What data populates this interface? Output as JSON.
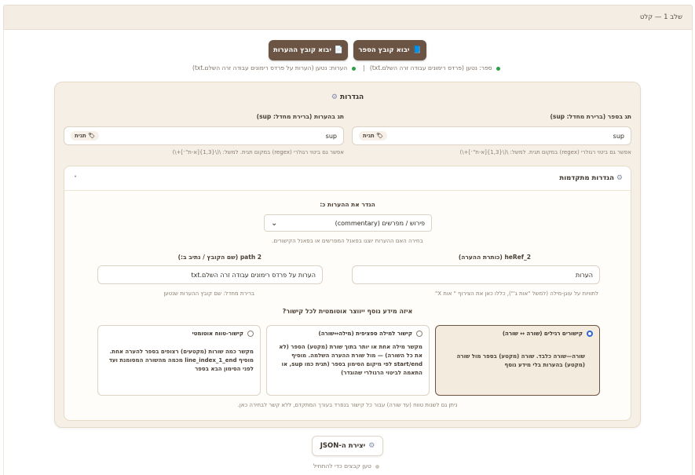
{
  "step": {
    "label": "שלב 1 — קלט"
  },
  "buttons": {
    "import_book": "יבוא קובץ הספר",
    "import_notes": "יבוא קובץ ההערות",
    "create_json": "יצירת ה-JSON"
  },
  "status": {
    "book": "ספר: נטען (פרדס רימונים עבודה זרה השלם.txt)",
    "separator": "|",
    "notes": "הערות: נטען (הערות על פרדס רימונים עבודה זרה השלם.txt)",
    "book_color": "#2e9d4a"
  },
  "settings": {
    "title": "הגדרות",
    "book_tag": {
      "label": "תג בספר (ברירת מחדל: sup)",
      "value": "sup",
      "chip": "תגית",
      "hint": "אפשר גם ביטוי רגולרי (regex) במקום תגית. למשל: \\(\\{1,3}[א-ת\"׳]+\\)"
    },
    "notes_tag": {
      "label": "תג בהערות (ברירת מחדל: sup)",
      "value": "sup",
      "chip": "תגית",
      "hint": "אפשר גם ביטוי רגולרי (regex) במקום תגית. למשל: \\(\\{1,3}[א-ת\"׳]+\\)"
    }
  },
  "advanced": {
    "title": "הגדרות מתקדמות",
    "caret": "˄",
    "define_label": "הגדר את ההערות כ:",
    "select_value": "פירוש / מפרשים (commentary)",
    "select_hint": "בחירה האם ההערות יוצגו בפאנל המפרשים או בפאנל הקישורים.",
    "heref": {
      "label": "heRef_2 (כותרת ההערה)",
      "value": "הערות",
      "hint": "לתוויות על עוגן-מילה (למשל \"אות ג'\"), כללו כאן את הצירוף \" אות X\""
    },
    "path": {
      "label": "path 2 (שם הקובץ / נתיב ב:)",
      "value": "הערות על פרדס רימונים עבודה זרה השלם.txt",
      "hint": "ברירת מחדל: שם קובץ ההערות שנטען"
    },
    "question": "איזה מידע נוסף ייווצר אוטומטית לכל קישור?",
    "options": [
      {
        "title": "קישורים רגילים (שורה ↔ שורה)",
        "desc": "שורה—שורה כלבד. שורה (מקטע) בספר מול שורה (מקטע) בהערות בלי מידע נוסף",
        "selected": true
      },
      {
        "title": "קישור למילה ספציפית (מילה↔שורה)",
        "desc": "מקשר מילה אחת או יותר בתוך שורת (מקטע) הספר (לא את כל השורה) — מול שורת ההערה השלמה. מוסיף start/end לפי מיקום הסימון בספר (תגית כמו sup, או התאמה לביטוי הרגולרי שהוגדר)",
        "selected": false
      },
      {
        "title": "קישור-טווח אוטומטי",
        "desc": "מקשר כמה שורות (מקטעים) רצופים בספר להערה אחת. מוסיף line_index_1_end מכמה מהשורה המסומנת ועד לפני הסימון הבא בספר",
        "selected": false
      }
    ],
    "footer_hint": "ניתן גם לשנות טווח (עד שורה) עבור כל קישור בנפרד בעורך המתקדם, ללא קשר לבחירה כאן."
  },
  "bottom": {
    "hint": "טען קבצים כדי להתחיל"
  }
}
